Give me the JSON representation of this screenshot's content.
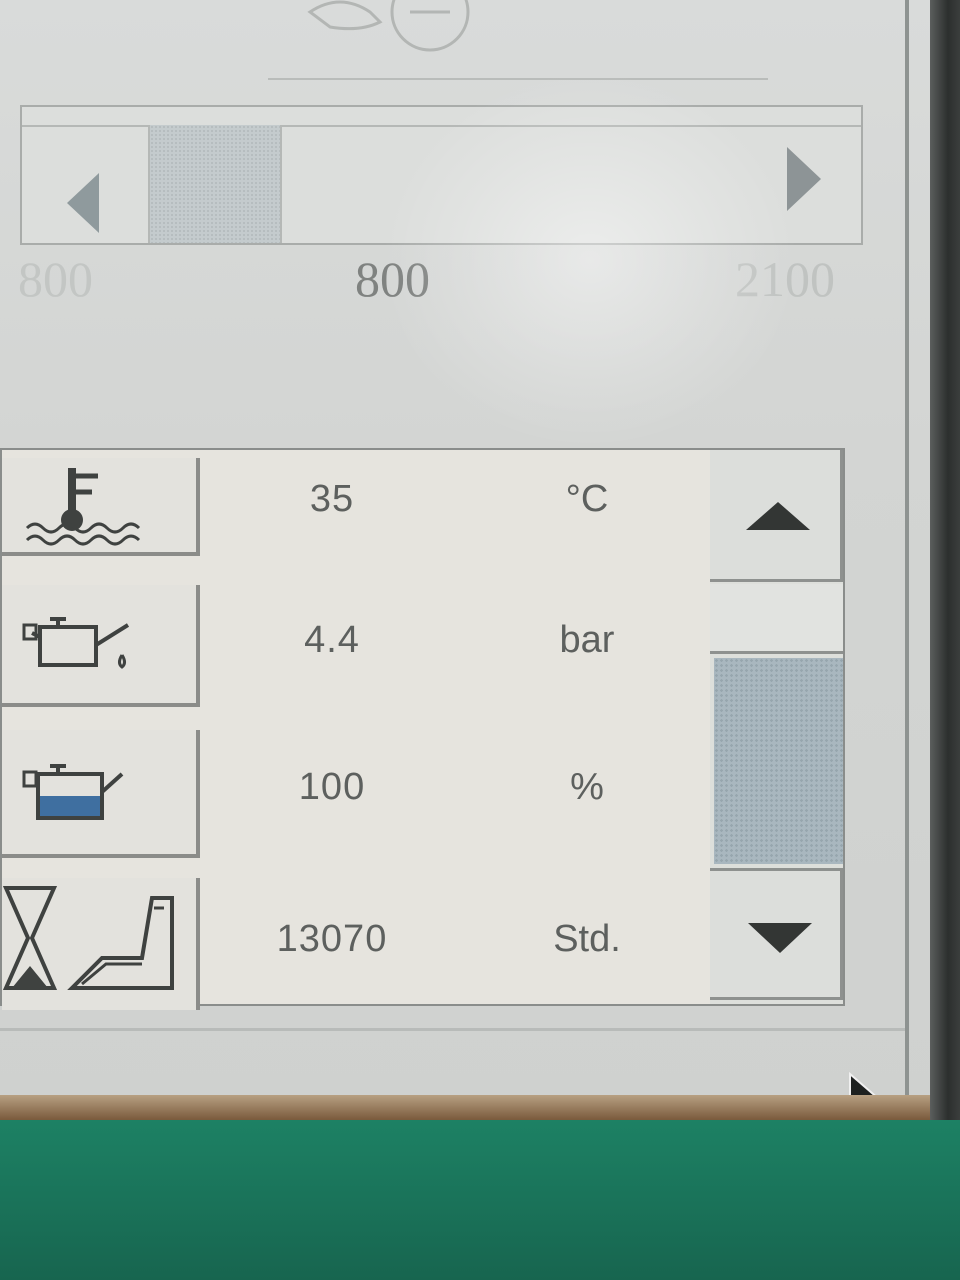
{
  "rpm_slider": {
    "min_label": "800",
    "current_label": "800",
    "max_label": "2100",
    "left_arrow": "decrease-arrow",
    "right_arrow": "increase-arrow"
  },
  "gauges": [
    {
      "icon": "coolant-temperature-icon",
      "value": "35",
      "unit": "°C"
    },
    {
      "icon": "oil-pressure-icon",
      "value": "4.4",
      "unit": "bar"
    },
    {
      "icon": "oil-level-icon",
      "value": "100",
      "unit": "%"
    },
    {
      "icon": "operating-hours-icon",
      "value": "13070",
      "unit": "Std."
    }
  ],
  "scrollbar": {
    "up_icon": "triangle-up-icon",
    "down_icon": "triangle-down-icon"
  },
  "colors": {
    "screen": "#d9dbda",
    "panel": "#e6e4de",
    "text": "#5d605e",
    "scroll_thumb": "#a9b7bf",
    "bezel_green": "#1d8164"
  }
}
